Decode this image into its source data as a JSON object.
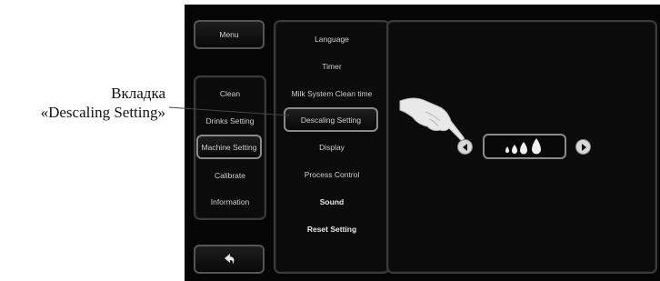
{
  "callout": {
    "line1": "Вкладка",
    "line2": "«Descaling Setting»"
  },
  "left_menu": {
    "menu_label": "Menu",
    "items": [
      {
        "label": "Clean"
      },
      {
        "label": "Drinks Setting"
      },
      {
        "label": "Machine Setting",
        "selected": true
      },
      {
        "label": "Calibrate"
      },
      {
        "label": "Information"
      }
    ],
    "back_icon": "back-arrow-icon"
  },
  "middle_menu": {
    "items": [
      {
        "label": "Language"
      },
      {
        "label": "Timer"
      },
      {
        "label": "Milk System Clean time"
      },
      {
        "label": "Descaling Setting",
        "selected": true
      },
      {
        "label": "Display"
      },
      {
        "label": "Process Control"
      },
      {
        "label": "Sound",
        "bold": true
      },
      {
        "label": "Reset Setting",
        "bold": true
      }
    ]
  },
  "right_panel": {
    "left_arrow_icon": "arrow-left-icon",
    "right_arrow_icon": "arrow-right-icon",
    "drop_icon": "water-drop-icon",
    "hand_icon": "pointing-hand-icon",
    "hardness_level": 4
  },
  "colors": {
    "screen_bg": "#050505",
    "panel_border": "#3a3a3a",
    "text": "#cfcfcf"
  }
}
